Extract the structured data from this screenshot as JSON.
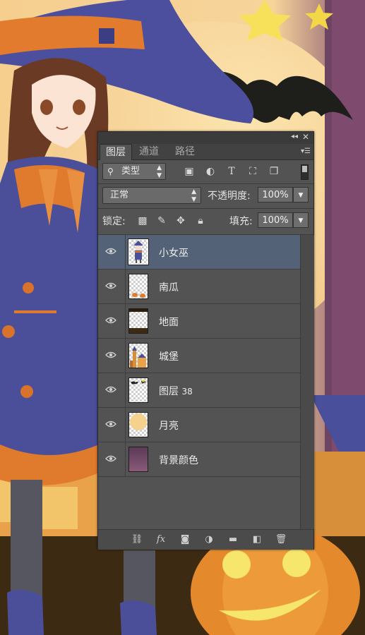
{
  "panel": {
    "tabs": [
      {
        "label": "图层",
        "active": true
      },
      {
        "label": "通道",
        "active": false
      },
      {
        "label": "路径",
        "active": false
      }
    ],
    "filter": {
      "label": "类型"
    },
    "blend_mode": "正常",
    "opacity_label": "不透明度:",
    "opacity_value": "100%",
    "lock_label": "锁定:",
    "fill_label": "填充:",
    "fill_value": "100%",
    "layers": [
      {
        "name": "小女巫",
        "selected": true,
        "visible": true,
        "thumb_icon": "witch-thumbnail"
      },
      {
        "name": "南瓜",
        "selected": false,
        "visible": true,
        "thumb_icon": "pumpkin-thumbnail"
      },
      {
        "name": "地面",
        "selected": false,
        "visible": true,
        "thumb_icon": "ground-thumbnail"
      },
      {
        "name": "城堡",
        "selected": false,
        "visible": true,
        "thumb_icon": "castle-thumbnail"
      },
      {
        "name": "图层",
        "number": "38",
        "selected": false,
        "visible": true,
        "thumb_icon": "bat-thumbnail"
      },
      {
        "name": "月亮",
        "selected": false,
        "visible": true,
        "thumb_icon": "moon-thumbnail"
      },
      {
        "name": "背景颜色",
        "selected": false,
        "visible": true,
        "thumb_icon": "gradient-thumbnail"
      }
    ]
  },
  "colors": {
    "panel_bg": "#535353",
    "selected_row": "#536277",
    "sky": "#f5d9a0",
    "witch_robe": "#4b4f9a",
    "accent_orange": "#e07a2c"
  }
}
